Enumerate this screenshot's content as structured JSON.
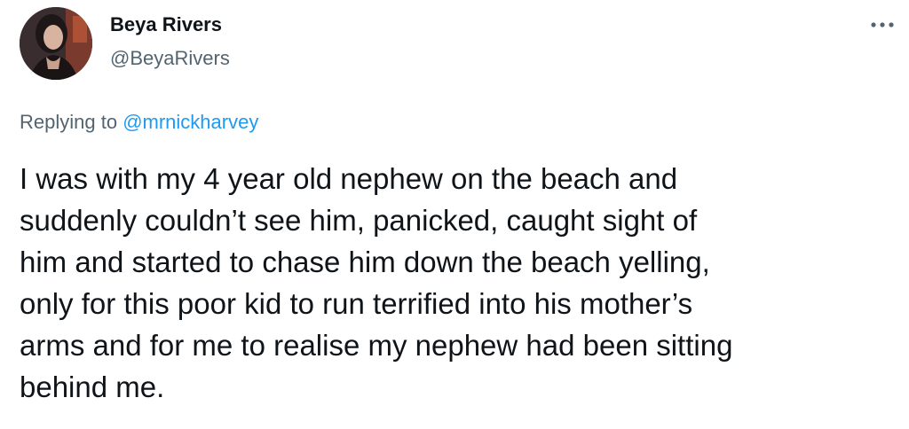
{
  "author": {
    "display_name": "Beya Rivers",
    "handle": "@BeyaRivers",
    "avatar_icon": "profile-photo"
  },
  "actions": {
    "more_icon": "more-horizontal-icon"
  },
  "reply": {
    "prefix": "Replying to ",
    "handle": "@mrnickharvey"
  },
  "tweet": {
    "text": "I was with my 4 year old nephew on the beach and\nsuddenly couldn’t see him, panicked, caught sight of\nhim and started to chase him down the beach yelling,\nonly for this poor kid to run terrified into his mother’s\narms and for me to realise my nephew had been sitting\nbehind me."
  },
  "colors": {
    "text_primary": "#0f1419",
    "text_secondary": "#536471",
    "link": "#1d9bf0"
  }
}
